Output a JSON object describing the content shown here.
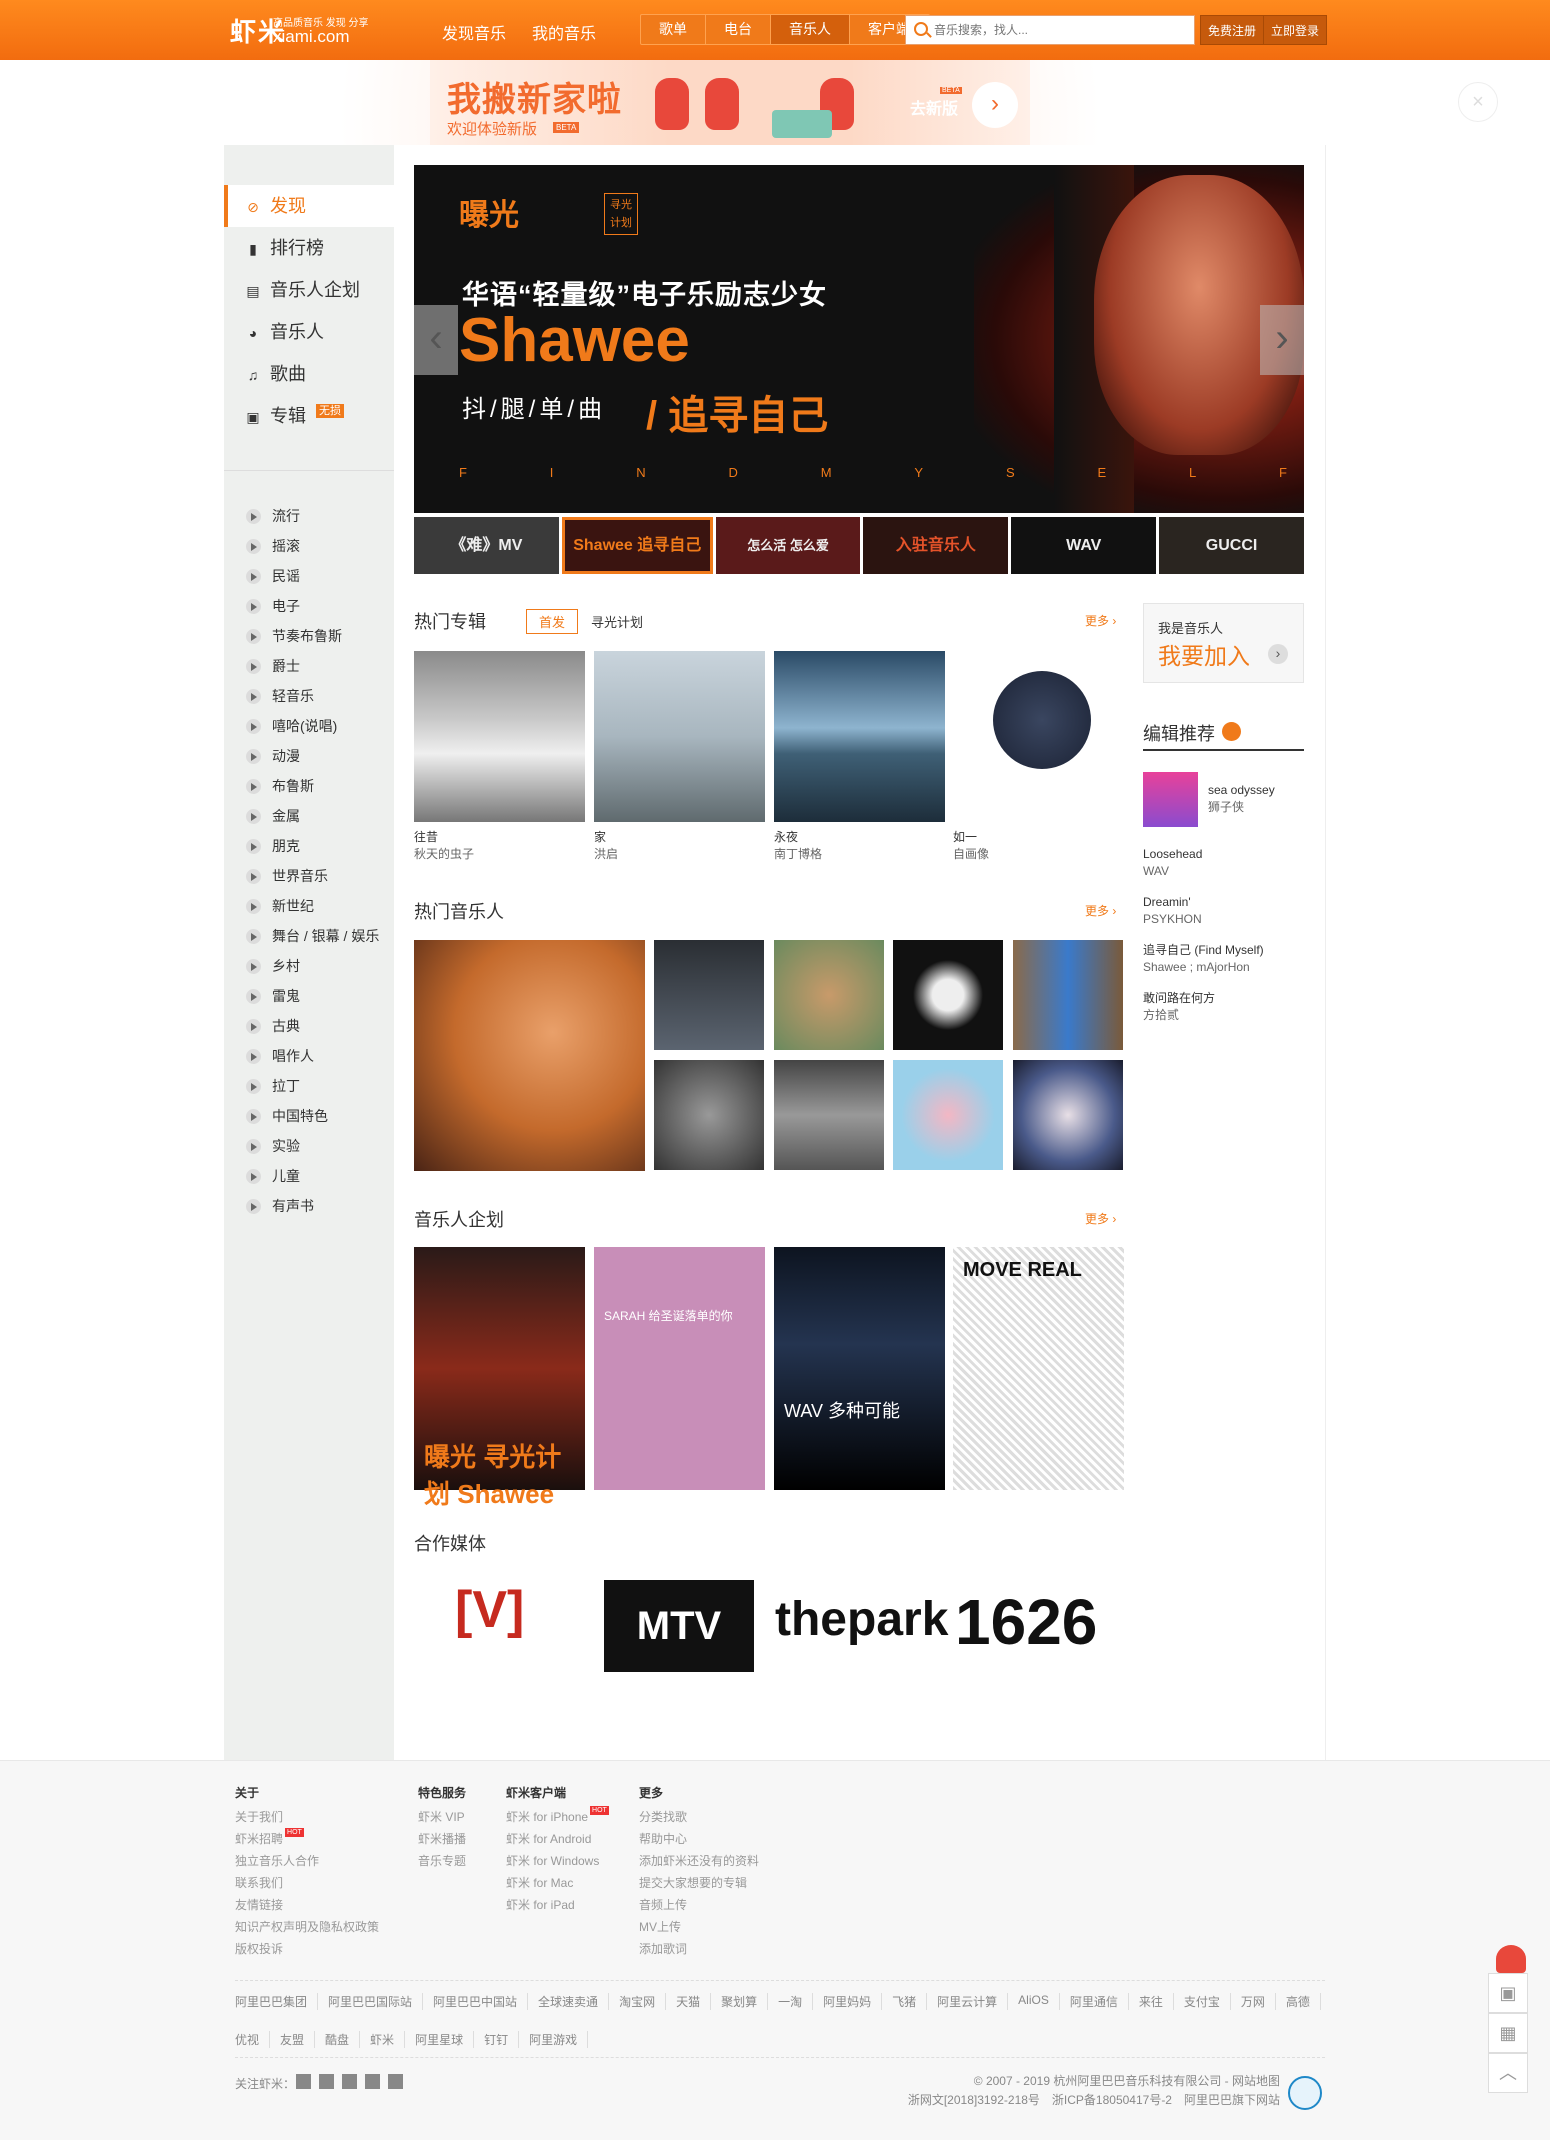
{
  "topbar": {
    "logo_cn": "虾米",
    "logo_domain": "xiami.com",
    "logo_slogan": "高品质音乐 发现 分享",
    "nav": [
      "发现音乐",
      "我的音乐"
    ],
    "subnav": [
      "歌单",
      "电台",
      "音乐人",
      "客户端"
    ],
    "subnav_active": "音乐人",
    "search_placeholder": "音乐搜索，找人...",
    "register": "免费注册",
    "login": "立即登录"
  },
  "banner": {
    "title": "我搬新家啦",
    "subtitle": "欢迎体验新版",
    "beta": "BETA",
    "go_new": "去新版",
    "go_arrow": "›",
    "close": "×"
  },
  "sidebar": {
    "main": [
      {
        "label": "发现",
        "icon": "⊘"
      },
      {
        "label": "排行榜",
        "icon": "▮"
      },
      {
        "label": "音乐人企划",
        "icon": "▤"
      },
      {
        "label": "音乐人",
        "icon": "◕"
      },
      {
        "label": "歌曲",
        "icon": "♫"
      },
      {
        "label": "专辑",
        "icon": "▣"
      }
    ],
    "album_badge": "无损",
    "genres": [
      "流行",
      "摇滚",
      "民谣",
      "电子",
      "节奏布鲁斯",
      "爵士",
      "轻音乐",
      "嘻哈(说唱)",
      "动漫",
      "布鲁斯",
      "金属",
      "朋克",
      "世界音乐",
      "新世纪",
      "舞台 / 银幕 / 娱乐",
      "乡村",
      "雷鬼",
      "古典",
      "唱作人",
      "拉丁",
      "中国特色",
      "实验",
      "儿童",
      "有声书"
    ]
  },
  "hero": {
    "logo": "曝光",
    "logo2": "寻光计划",
    "line1": "华语“轻量级”电子乐励志少女",
    "name": "Shawee",
    "line3": "抖/腿/单/曲",
    "line4": "/ 追寻自己",
    "letters": [
      "F",
      "I",
      "N",
      "D",
      "M",
      "Y",
      "S",
      "E",
      "L",
      "F"
    ],
    "prev": "‹",
    "next": "›",
    "thumbs": [
      "《难》MV",
      "Shawee 追寻自己",
      "怎么活 怎么爱",
      "入驻音乐人",
      "WAV",
      "GUCCI"
    ]
  },
  "hot_albums": {
    "title": "热门专辑",
    "tabs": [
      "首发",
      "寻光计划"
    ],
    "more": "更多 ›",
    "items": [
      {
        "name": "往昔",
        "artist": "秋天的虫子"
      },
      {
        "name": "家",
        "artist": "洪启"
      },
      {
        "name": "永夜",
        "artist": "南丁博格"
      },
      {
        "name": "如一",
        "artist": "自画像"
      }
    ]
  },
  "hot_artists": {
    "title": "热门音乐人",
    "more": "更多 ›"
  },
  "projects": {
    "title": "音乐人企划",
    "more": "更多 ›",
    "items": [
      "曝光 寻光计划 Shawee",
      "SARAH 给圣诞落单的你",
      "WAV 多种可能",
      "MOVE REAL"
    ]
  },
  "media": {
    "title": "合作媒体",
    "items": [
      "[V]",
      "MTV",
      "thepark",
      "1626"
    ]
  },
  "right": {
    "join_small": "我是音乐人",
    "join_big": "我要加入",
    "join_arrow": "›",
    "editor_title": "编辑推荐",
    "recs": [
      {
        "song": "sea odyssey",
        "artist": "狮子侠"
      },
      {
        "song": "Loosehead",
        "artist": "WAV"
      },
      {
        "song": "Dreamin'",
        "artist": "PSYKHON"
      },
      {
        "song": "追寻自己 (Find Myself)",
        "artist": "Shawee ; mAjorHon"
      },
      {
        "song": "敢问路在何方",
        "artist": "方拾贰"
      }
    ]
  },
  "footer": {
    "cols": [
      {
        "title": "关于",
        "items": [
          "关于我们",
          "虾米招聘",
          "独立音乐人合作",
          "联系我们",
          "友情链接",
          "知识产权声明及隐私权政策",
          "版权投诉"
        ]
      },
      {
        "title": "特色服务",
        "items": [
          "虾米 VIP",
          "虾米播播",
          "音乐专题"
        ]
      },
      {
        "title": "虾米客户端",
        "items": [
          "虾米 for iPhone",
          "虾米 for Android",
          "虾米 for Windows",
          "虾米 for Mac",
          "虾米 for iPad"
        ]
      },
      {
        "title": "更多",
        "items": [
          "分类找歌",
          "帮助中心",
          "添加虾米还没有的资料",
          "提交大家想要的专辑",
          "音频上传",
          "MV上传",
          "添加歌词"
        ]
      }
    ],
    "hot_tag": "HOT",
    "links1": [
      "阿里巴巴集团",
      "阿里巴巴国际站",
      "阿里巴巴中国站",
      "全球速卖通",
      "淘宝网",
      "天猫",
      "聚划算",
      "一淘",
      "阿里妈妈",
      "飞猪",
      "阿里云计算",
      "AliOS",
      "阿里通信",
      "来往",
      "支付宝",
      "万网",
      "高德"
    ],
    "links2": [
      "优视",
      "友盟",
      "酷盘",
      "虾米",
      "阿里星球",
      "钉钉",
      "阿里游戏"
    ],
    "follow": "关注虾米：",
    "copyright": "© 2007 - 2019 杭州阿里巴巴音乐科技有限公司 - 网站地图",
    "icp": "浙网文[2018]3192-218号　浙ICP备18050417号-2　阿里巴巴旗下网站"
  }
}
